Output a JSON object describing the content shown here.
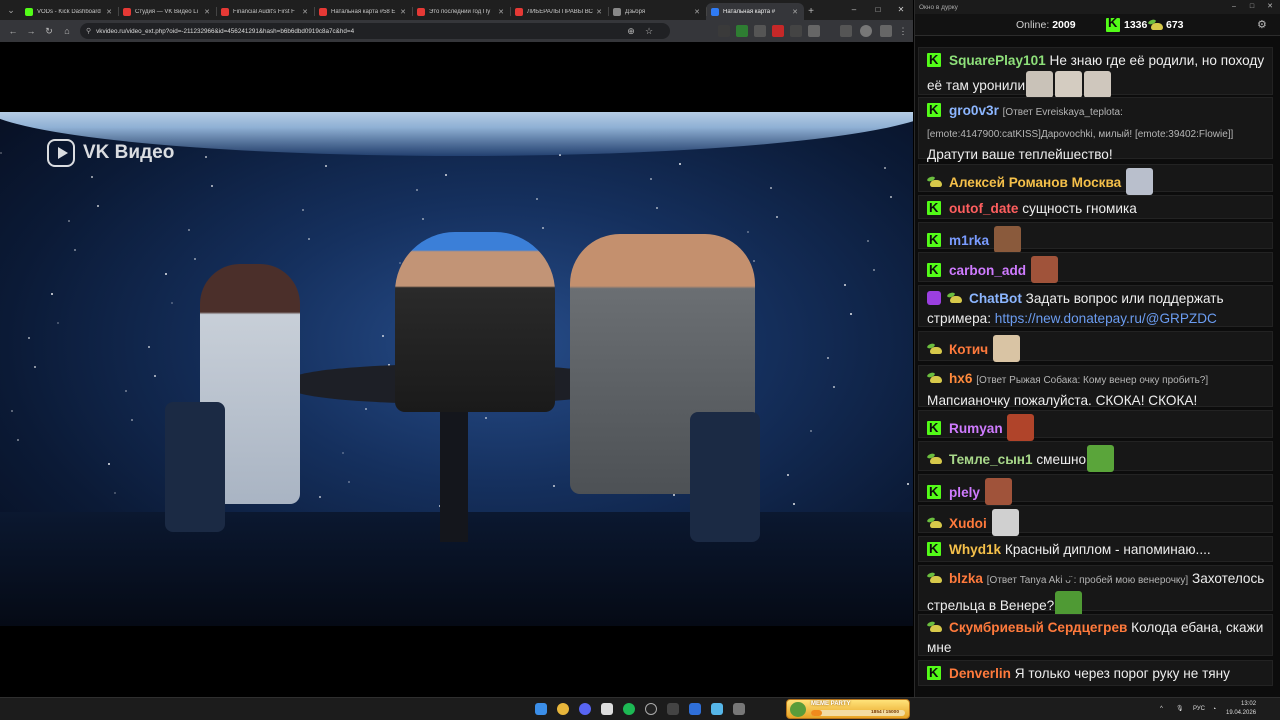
{
  "browser": {
    "tabs": [
      {
        "title": "VODs - Kick Dashboard",
        "favicon_color": "#53fc18",
        "active": false
      },
      {
        "title": "Студия — VK Видео Li",
        "favicon_color": "#e53935",
        "active": false
      },
      {
        "title": "Financial Audit's First F",
        "favicon_color": "#e53935",
        "active": false
      },
      {
        "title": "Натальная карта #58 Е",
        "favicon_color": "#e53935",
        "active": false
      },
      {
        "title": "Это последний год Пу",
        "favicon_color": "#e53935",
        "active": false
      },
      {
        "title": "ЛИБЕРАЛЫ ПРАВЫ ВС",
        "favicon_color": "#e53935",
        "active": false
      },
      {
        "title": "Дзьбря",
        "favicon_color": "#888888",
        "active": false
      },
      {
        "title": "Натальная карта #",
        "favicon_color": "#2f7bf5",
        "active": true
      }
    ],
    "new_tab": "+",
    "window_controls": {
      "minimize": "–",
      "maximize": "□",
      "close": "✕"
    },
    "toolbar": {
      "back": "←",
      "forward": "→",
      "reload": "↻",
      "home": "⌂",
      "url": "vkvideo.ru/video_ext.php?oid=-211232966&id=456241291&hash=b6b6dbd0919c8a7c&hd=4",
      "zoom_icon": "⊕",
      "star_icon": "☆"
    }
  },
  "video": {
    "logo_text": "VK Видео"
  },
  "chat": {
    "window_title": "Окно в дурку",
    "stats": {
      "online_label": "Online:",
      "online_count": "2009",
      "kick_count": "1336",
      "other_count": "673"
    },
    "messages": [
      {
        "badge": "kick",
        "user": "SquarePlay101",
        "color": "#8ee07a",
        "text": "Не знаю где её родили, но походу её там уронили",
        "emotes": [
          "#c9c2b8",
          "#d4ccc1",
          "#cfc7bd"
        ]
      },
      {
        "badge": "kick",
        "user": "gro0v3r",
        "color": "#8cb6ff",
        "reply": "[Ответ Evreiskaya_teplota: [emote:4147900:catKISS]Дарovochki, милый! [emote:39402:Flowie]]",
        "text": "Дратути ваше теплейшество!",
        "emotes": []
      },
      {
        "badge": "sub",
        "user": "Алексей Романов Москва",
        "color": "#f5c04a",
        "text": "",
        "emotes": [
          "#b9bfcc"
        ]
      },
      {
        "badge": "kick",
        "user": "outof_date",
        "color": "#ff5f5f",
        "text": "сущность гномика",
        "emotes": []
      },
      {
        "badge": "kick",
        "user": "m1rka",
        "color": "#7a9cff",
        "text": "",
        "emotes": [
          "#8a5a3c"
        ]
      },
      {
        "badge": "kick",
        "user": "carbon_add",
        "color": "#cf7bff",
        "text": "",
        "emotes": [
          "#a0533a"
        ]
      },
      {
        "badge": "bot",
        "user": "ChatBot",
        "color": "#8cb6ff",
        "text": "Задать вопрос или поддержать стримера: ",
        "link": "https://new.donatepay.ru/@GRPZDC",
        "emotes": []
      },
      {
        "badge": "sub",
        "user": "Котич",
        "color": "#ff7a3c",
        "text": "",
        "emotes": [
          "#d9c4a4"
        ]
      },
      {
        "badge": "sub",
        "user": "hx6",
        "color": "#ff8a3c",
        "reply": "[Ответ Рыжая Собака: Кому венер очку пробить?]",
        "text": "Мапсианочку пожалуйста. СКОКА! СКОКА!",
        "emotes": []
      },
      {
        "badge": "kick",
        "user": "Rumyan",
        "color": "#cf7bff",
        "text": "",
        "emotes": [
          "#b0442a"
        ]
      },
      {
        "badge": "sub",
        "user": "Темле_сын1",
        "color": "#a8d88a",
        "text": "смешно",
        "emotes": [
          "#5aa53a"
        ]
      },
      {
        "badge": "kick",
        "user": "plely",
        "color": "#cf7bff",
        "text": "",
        "emotes": [
          "#a0533a"
        ]
      },
      {
        "badge": "sub",
        "user": "Xudoi",
        "color": "#ff7a3c",
        "text": "",
        "emotes": [
          "#d0d0d0"
        ]
      },
      {
        "badge": "kick",
        "user": "Whyd1k",
        "color": "#f5c04a",
        "text": "Красный диплом - напоминаю....",
        "emotes": []
      },
      {
        "badge": "sub",
        "user": "blzka",
        "color": "#ff7a3c",
        "reply": "[Ответ Tanya Aki ᴗ̈ : пробей мою венерочку]",
        "text": "Захотелось стрельца в Венере?",
        "emotes": [
          "#4f9a34"
        ]
      },
      {
        "badge": "sub",
        "user": "Скумбриевый Сердцегрев",
        "color": "#ff7a3c",
        "text": "Колода ебана, скажи мне",
        "emotes": []
      },
      {
        "badge": "kick",
        "user": "Denverlin",
        "color": "#ff7a3c",
        "text": "Я только через порог руку не тяну",
        "emotes": []
      }
    ]
  },
  "taskbar": {
    "widget_title": "MEME PARTY",
    "widget_progress_text": "1854 / 15000",
    "widget_progress_fraction": 0.12,
    "lang": "РУС",
    "time": "13:02",
    "date": "19.04.2026"
  }
}
